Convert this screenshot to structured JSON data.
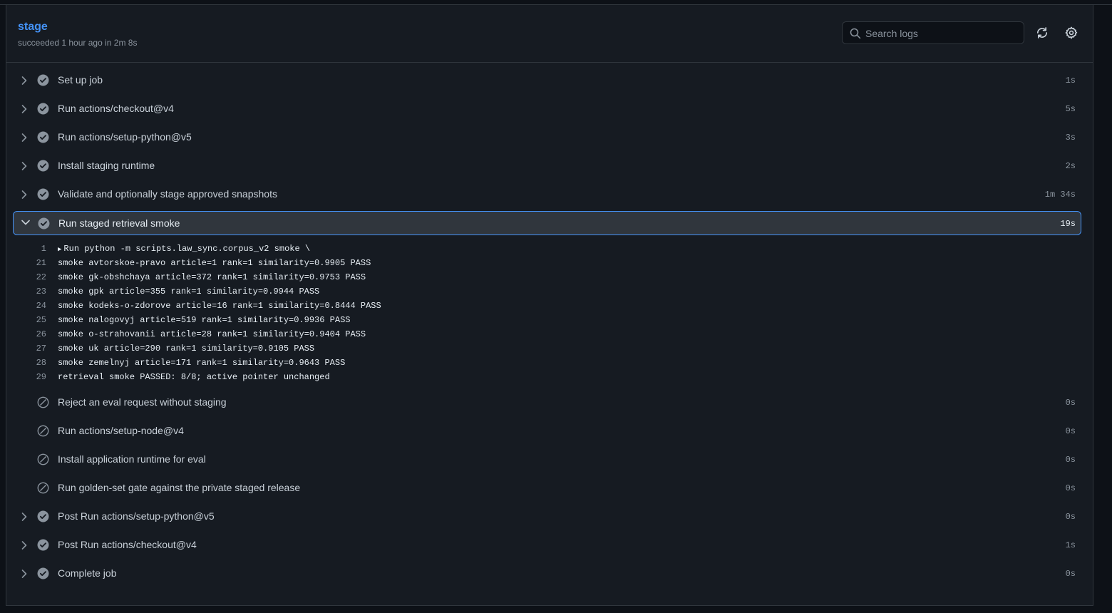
{
  "job": {
    "title": "stage",
    "subtitle": "succeeded 1 hour ago in 2m 8s"
  },
  "search": {
    "placeholder": "Search logs"
  },
  "icons": {
    "refresh": "sync-icon",
    "settings": "gear-icon",
    "success": "check-circle-fill-icon",
    "skipped": "skip-icon",
    "expand": "chevron-right-icon",
    "collapse": "chevron-down-icon",
    "search": "search-icon"
  },
  "colors": {
    "accent": "#4493f8",
    "background": "#161b22",
    "border": "#30363d",
    "muted": "#8b949e"
  },
  "steps_before": [
    {
      "label": "Set up job",
      "duration": "1s",
      "status": "success"
    },
    {
      "label": "Run actions/checkout@v4",
      "duration": "5s",
      "status": "success"
    },
    {
      "label": "Run actions/setup-python@v5",
      "duration": "3s",
      "status": "success"
    },
    {
      "label": "Install staging runtime",
      "duration": "2s",
      "status": "success"
    },
    {
      "label": "Validate and optionally stage approved snapshots",
      "duration": "1m 34s",
      "status": "success"
    }
  ],
  "active_step": {
    "label": "Run staged retrieval smoke",
    "duration": "19s",
    "status": "success",
    "log": [
      {
        "line": "1",
        "text": "Run python -m scripts.law_sync.corpus_v2 smoke \\",
        "collapsible": true
      },
      {
        "line": "21",
        "text": "smoke avtorskoe-pravo article=1 rank=1 similarity=0.9905 PASS"
      },
      {
        "line": "22",
        "text": "smoke gk-obshchaya article=372 rank=1 similarity=0.9753 PASS"
      },
      {
        "line": "23",
        "text": "smoke gpk article=355 rank=1 similarity=0.9944 PASS"
      },
      {
        "line": "24",
        "text": "smoke kodeks-o-zdorove article=16 rank=1 similarity=0.8444 PASS"
      },
      {
        "line": "25",
        "text": "smoke nalogovyj article=519 rank=1 similarity=0.9936 PASS"
      },
      {
        "line": "26",
        "text": "smoke o-strahovanii article=28 rank=1 similarity=0.9404 PASS"
      },
      {
        "line": "27",
        "text": "smoke uk article=290 rank=1 similarity=0.9105 PASS"
      },
      {
        "line": "28",
        "text": "smoke zemelnyj article=171 rank=1 similarity=0.9643 PASS"
      },
      {
        "line": "29",
        "text": "retrieval smoke PASSED: 8/8; active pointer unchanged"
      }
    ]
  },
  "steps_after": [
    {
      "label": "Reject an eval request without staging",
      "duration": "0s",
      "status": "skipped"
    },
    {
      "label": "Run actions/setup-node@v4",
      "duration": "0s",
      "status": "skipped"
    },
    {
      "label": "Install application runtime for eval",
      "duration": "0s",
      "status": "skipped"
    },
    {
      "label": "Run golden-set gate against the private staged release",
      "duration": "0s",
      "status": "skipped"
    },
    {
      "label": "Post Run actions/setup-python@v5",
      "duration": "0s",
      "status": "success"
    },
    {
      "label": "Post Run actions/checkout@v4",
      "duration": "1s",
      "status": "success"
    },
    {
      "label": "Complete job",
      "duration": "0s",
      "status": "success"
    }
  ]
}
